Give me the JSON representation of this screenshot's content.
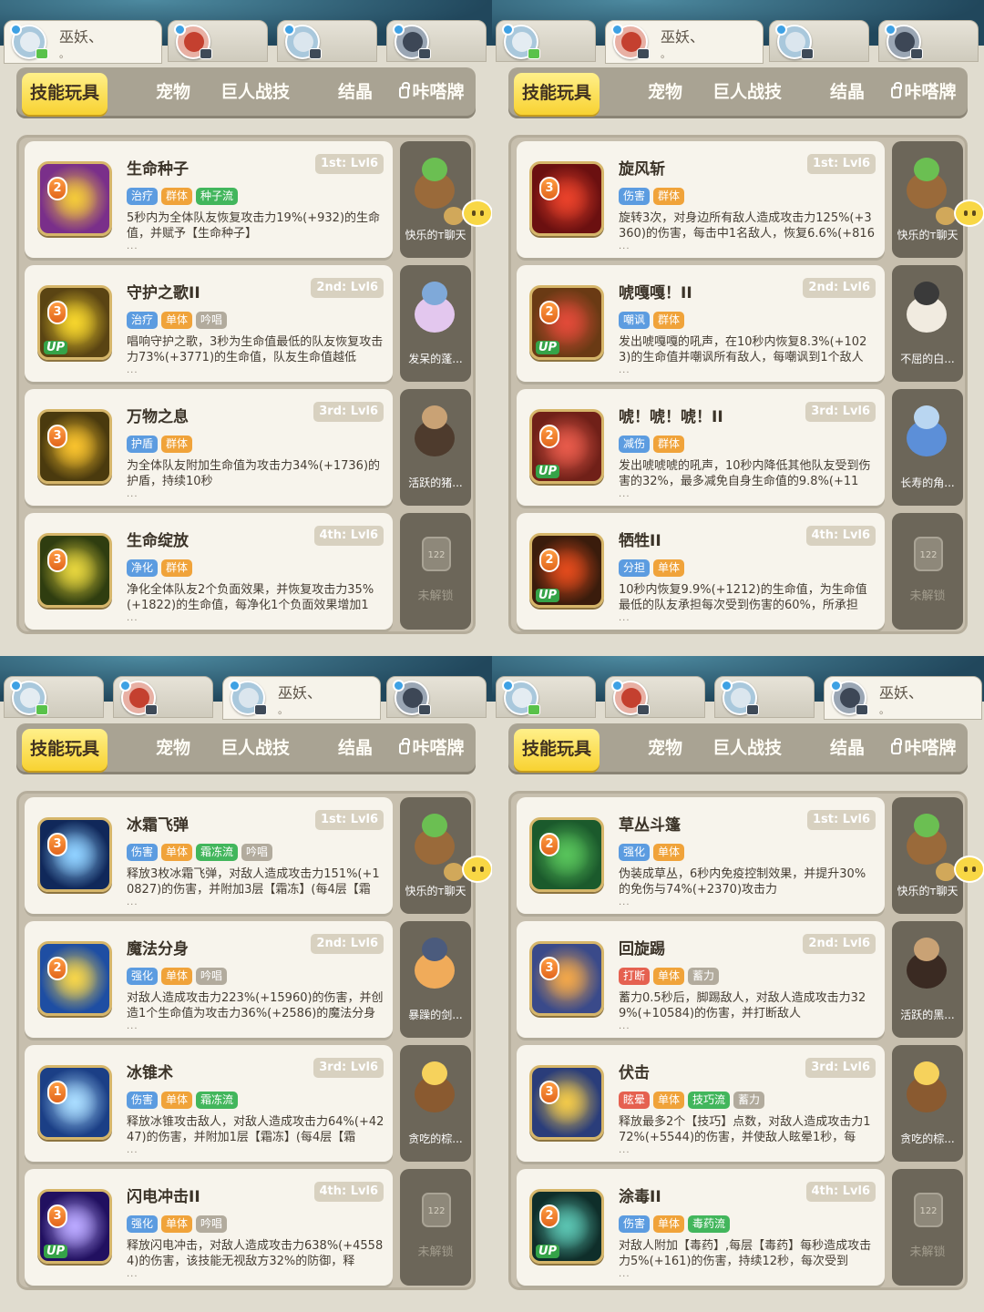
{
  "panels": [
    {
      "active_tab_char": 0,
      "chars": [
        {
          "name": "巫妖、",
          "sub": "。",
          "status": "chat",
          "colors": [
            "#a9c8dc",
            "#e4ecf2"
          ]
        },
        {
          "colors": [
            "#e8b0a4",
            "#c4402f"
          ]
        },
        {
          "colors": [
            "#a9c8dc",
            "#dbe6ee"
          ]
        },
        {
          "colors": [
            "#9aa6b4",
            "#3d4756"
          ]
        }
      ],
      "tabs": [
        "技能玩具",
        "宠物",
        "巨人战技",
        "结晶",
        "咔嗒牌"
      ],
      "skills": [
        {
          "lvl": "2",
          "up": false,
          "name": "生命种子",
          "slot": "1st: Lvl6",
          "tags": [
            [
              "治疗",
              "blue"
            ],
            [
              "群体",
              "orange"
            ],
            [
              "种子流",
              "green"
            ]
          ],
          "desc": "5秒内为全体队友恢复攻击力19%(+932)的生命值，并赋予【生命种子】",
          "icon": [
            "#7a2f8a",
            "#f3c93a"
          ],
          "pet": {
            "name": "快乐的т聊天",
            "c": [
              "#9a6a3a",
              "#6bbf52"
            ]
          }
        },
        {
          "lvl": "3",
          "up": true,
          "name": "守护之歌II",
          "slot": "2nd: Lvl6",
          "tags": [
            [
              "治疗",
              "blue"
            ],
            [
              "单体",
              "orange"
            ],
            [
              "吟唱",
              "gray"
            ]
          ],
          "desc": "唱响守护之歌，3秒为生命值最低的队友恢复攻击力73%(+3771)的生命值，队友生命值越低",
          "icon": [
            "#5a4413",
            "#f5d42c"
          ],
          "pet": {
            "name": "发呆的蓬...",
            "c": [
              "#e3c7ee",
              "#7fa9d9"
            ]
          }
        },
        {
          "lvl": "3",
          "up": false,
          "name": "万物之息",
          "slot": "3rd: Lvl6",
          "tags": [
            [
              "护盾",
              "blue"
            ],
            [
              "群体",
              "orange"
            ]
          ],
          "desc": "为全体队友附加生命值为攻击力34%(+1736)的护盾，持续10秒",
          "icon": [
            "#4a3a0e",
            "#f7c12d"
          ],
          "pet": {
            "name": "活跃的猪...",
            "c": [
              "#4e3b2d",
              "#c9a275"
            ]
          }
        },
        {
          "lvl": "3",
          "up": false,
          "name": "生命绽放",
          "slot": "4th: Lvl6",
          "tags": [
            [
              "净化",
              "blue"
            ],
            [
              "群体",
              "orange"
            ]
          ],
          "desc": "净化全体队友2个负面效果，并恢复攻击力35%(+1822)的生命值，每净化1个负面效果增加1",
          "icon": [
            "#2f3d10",
            "#e4d33d"
          ],
          "locked": true,
          "unlock": "未解锁",
          "lockno": "122"
        }
      ]
    },
    {
      "active_tab_char": 1,
      "chars": [
        {
          "colors": [
            "#a9c8dc",
            "#e4ecf2"
          ]
        },
        {
          "name": "巫妖、",
          "sub": "。",
          "colors": [
            "#e8b0a4",
            "#c4402f"
          ]
        },
        {
          "colors": [
            "#a9c8dc",
            "#dbe6ee"
          ]
        },
        {
          "colors": [
            "#9aa6b4",
            "#3d4756"
          ]
        }
      ],
      "tabs": [
        "技能玩具",
        "宠物",
        "巨人战技",
        "结晶",
        "咔嗒牌"
      ],
      "skills": [
        {
          "lvl": "3",
          "up": false,
          "name": "旋风斩",
          "slot": "1st: Lvl6",
          "tags": [
            [
              "伤害",
              "blue"
            ],
            [
              "群体",
              "orange"
            ]
          ],
          "desc": "旋转3次，对身边所有敌人造成攻击力125%(+3360)的伤害，每击中1名敌人，恢复6.6%(+816",
          "icon": [
            "#6b1010",
            "#e8412a"
          ],
          "pet": {
            "name": "快乐的т聊天",
            "c": [
              "#9a6a3a",
              "#6bbf52"
            ]
          }
        },
        {
          "lvl": "2",
          "up": true,
          "name": "唬嘎嘎！II",
          "slot": "2nd: Lvl6",
          "tags": [
            [
              "嘲讽",
              "blue"
            ],
            [
              "群体",
              "orange"
            ]
          ],
          "desc": "发出唬嘎嘎的吼声，在10秒内恢复8.3%(+1023)的生命值并嘲讽所有敌人，每嘲讽到1个敌人",
          "icon": [
            "#6a3a14",
            "#e04a38"
          ],
          "pet": {
            "name": "不屈的白...",
            "c": [
              "#f1ebe0",
              "#3a3a3a"
            ]
          }
        },
        {
          "lvl": "2",
          "up": true,
          "name": "唬！唬！唬！II",
          "slot": "3rd: Lvl6",
          "tags": [
            [
              "减伤",
              "blue"
            ],
            [
              "群体",
              "orange"
            ]
          ],
          "desc": "发出唬唬唬的吼声，10秒内降低其他队友受到伤害的32%，最多减免自身生命值的9.8%(+11",
          "icon": [
            "#702018",
            "#e65a4a"
          ],
          "pet": {
            "name": "长寿的角...",
            "c": [
              "#5c8fd8",
              "#b9d6f1"
            ]
          }
        },
        {
          "lvl": "2",
          "up": true,
          "name": "牺牲II",
          "slot": "4th: Lvl6",
          "tags": [
            [
              "分担",
              "blue"
            ],
            [
              "单体",
              "orange"
            ]
          ],
          "desc": "10秒内恢复9.9%(+1212)的生命值，为生命值最低的队友承担每次受到伤害的60%，所承担",
          "icon": [
            "#3a1c0c",
            "#e04a1c"
          ],
          "locked": true,
          "unlock": "未解锁",
          "lockno": "122"
        }
      ]
    },
    {
      "active_tab_char": 2,
      "chars": [
        {
          "colors": [
            "#a9c8dc",
            "#e4ecf2"
          ]
        },
        {
          "colors": [
            "#e8b0a4",
            "#c4402f"
          ]
        },
        {
          "name": "巫妖、",
          "sub": "。",
          "colors": [
            "#a9c8dc",
            "#dbe6ee"
          ]
        },
        {
          "colors": [
            "#9aa6b4",
            "#3d4756"
          ]
        }
      ],
      "tabs": [
        "技能玩具",
        "宠物",
        "巨人战技",
        "结晶",
        "咔嗒牌"
      ],
      "skills": [
        {
          "lvl": "3",
          "up": false,
          "name": "冰霜飞弹",
          "slot": "1st: Lvl6",
          "tags": [
            [
              "伤害",
              "blue"
            ],
            [
              "单体",
              "orange"
            ],
            [
              "霜冻流",
              "green"
            ],
            [
              "吟唱",
              "gray"
            ]
          ],
          "desc": "释放3枚冰霜飞弹，对敌人造成攻击力151%(+10827)的伤害，并附加3层【霜冻】(每4层【霜",
          "icon": [
            "#10285a",
            "#8fd0ff"
          ],
          "pet": {
            "name": "快乐的т聊天",
            "c": [
              "#9a6a3a",
              "#6bbf52"
            ]
          }
        },
        {
          "lvl": "2",
          "up": false,
          "name": "魔法分身",
          "slot": "2nd: Lvl6",
          "tags": [
            [
              "强化",
              "blue"
            ],
            [
              "单体",
              "orange"
            ],
            [
              "吟唱",
              "gray"
            ]
          ],
          "desc": "对敌人造成攻击力223%(+15960)的伤害，并创造1个生命值为攻击力36%(+2586)的魔法分身",
          "icon": [
            "#1e4ea3",
            "#f5d44a"
          ],
          "pet": {
            "name": "暴躁的剑...",
            "c": [
              "#f0ab5a",
              "#4b5b7d"
            ]
          }
        },
        {
          "lvl": "1",
          "up": false,
          "name": "冰锥术",
          "slot": "3rd: Lvl6",
          "tags": [
            [
              "伤害",
              "blue"
            ],
            [
              "单体",
              "orange"
            ],
            [
              "霜冻流",
              "green"
            ]
          ],
          "desc": "释放冰锥攻击敌人，对敌人造成攻击力64%(+4247)的伤害，并附加1层【霜冻】(每4层【霜",
          "icon": [
            "#1b3f86",
            "#a9dcff"
          ],
          "pet": {
            "name": "贪吃的棕...",
            "c": [
              "#8a5a30",
              "#f6d25c"
            ]
          }
        },
        {
          "lvl": "3",
          "up": true,
          "name": "闪电冲击II",
          "slot": "4th: Lvl6",
          "tags": [
            [
              "强化",
              "blue"
            ],
            [
              "单体",
              "orange"
            ],
            [
              "吟唱",
              "gray"
            ]
          ],
          "desc": "释放闪电冲击，对敌人造成攻击力638%(+45584)的伤害，该技能无视敌方32%的防御，释",
          "icon": [
            "#211060",
            "#b9a8ff"
          ],
          "locked": true,
          "unlock": "未解锁",
          "lockno": "122"
        }
      ]
    },
    {
      "active_tab_char": 3,
      "chars": [
        {
          "colors": [
            "#a9c8dc",
            "#e4ecf2"
          ]
        },
        {
          "colors": [
            "#e8b0a4",
            "#c4402f"
          ]
        },
        {
          "colors": [
            "#a9c8dc",
            "#dbe6ee"
          ]
        },
        {
          "name": "巫妖、",
          "sub": "。",
          "colors": [
            "#9aa6b4",
            "#3d4756"
          ]
        }
      ],
      "tabs": [
        "技能玩具",
        "宠物",
        "巨人战技",
        "结晶",
        "咔嗒牌"
      ],
      "skills": [
        {
          "lvl": "2",
          "up": false,
          "name": "草丛斗篷",
          "slot": "1st: Lvl6",
          "tags": [
            [
              "强化",
              "blue"
            ],
            [
              "单体",
              "orange"
            ]
          ],
          "desc": "伪装成草丛，6秒内免疫控制效果，并提升30%的免伤与74%(+2370)攻击力",
          "icon": [
            "#1b5a2c",
            "#57c25a"
          ],
          "pet": {
            "name": "快乐的т聊天",
            "c": [
              "#9a6a3a",
              "#6bbf52"
            ]
          }
        },
        {
          "lvl": "3",
          "up": false,
          "name": "回旋踢",
          "slot": "2nd: Lvl6",
          "tags": [
            [
              "打断",
              "red"
            ],
            [
              "单体",
              "orange"
            ],
            [
              "蓄力",
              "gray"
            ]
          ],
          "desc": "蓄力0.5秒后，脚踢敌人，对敌人造成攻击力329%(+10584)的伤害，并打断敌人",
          "icon": [
            "#3a4a8a",
            "#f0a64a"
          ],
          "pet": {
            "name": "活跃的黑...",
            "c": [
              "#3a2a22",
              "#c9a275"
            ]
          }
        },
        {
          "lvl": "3",
          "up": false,
          "name": "伏击",
          "slot": "3rd: Lvl6",
          "tags": [
            [
              "眩晕",
              "red"
            ],
            [
              "单体",
              "orange"
            ],
            [
              "技巧流",
              "green"
            ],
            [
              "蓄力",
              "gray"
            ]
          ],
          "desc": "释放最多2个【技巧】点数，对敌人造成攻击力172%(+5544)的伤害，并使敌人眩晕1秒，每",
          "icon": [
            "#2a3d7a",
            "#f0c84a"
          ],
          "pet": {
            "name": "贪吃的棕...",
            "c": [
              "#8a5a30",
              "#f6d25c"
            ]
          }
        },
        {
          "lvl": "2",
          "up": true,
          "name": "涂毒II",
          "slot": "4th: Lvl6",
          "tags": [
            [
              "伤害",
              "blue"
            ],
            [
              "单体",
              "orange"
            ],
            [
              "毒药流",
              "green"
            ]
          ],
          "desc": "对敌人附加【毒药】,每层【毒药】每秒造成攻击力5%(+161)的伤害，持续12秒，每次受到",
          "icon": [
            "#0f2e2a",
            "#5ac2b0"
          ],
          "locked": true,
          "unlock": "未解锁",
          "lockno": "122"
        }
      ]
    }
  ],
  "more_text": "..."
}
